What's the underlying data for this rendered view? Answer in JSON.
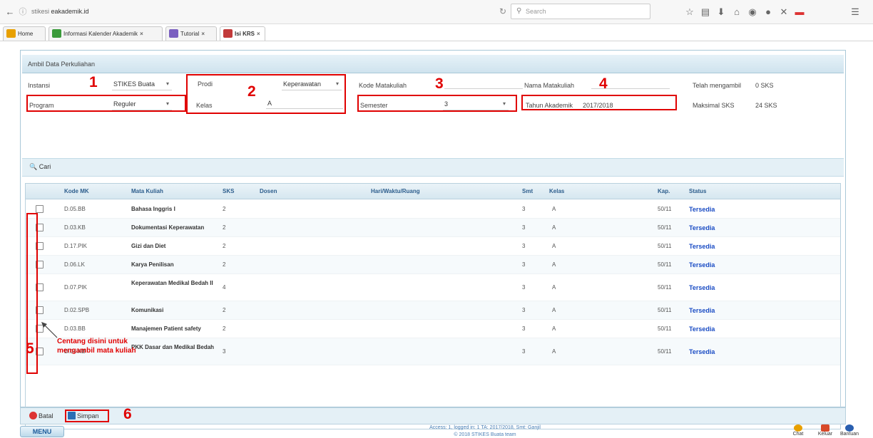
{
  "browser": {
    "url_prefix": "stikesi",
    "url_domain": "eakademik.id",
    "search_placeholder": "Search",
    "nav_back": "←",
    "nav_info": "ⓘ",
    "reload": "↻"
  },
  "tabs": [
    {
      "label": "Home",
      "color": "#e8a000"
    },
    {
      "label": "Informasi Kalender Akademik",
      "color": "#3a9a3a"
    },
    {
      "label": "Tutorial",
      "color": "#7a5fc0"
    },
    {
      "label": "Isi KRS",
      "color": "#c23a3a"
    }
  ],
  "panel": {
    "title": "Ambil Data Perkuliahan"
  },
  "form": {
    "instansi_label": "Instansi",
    "instansi_value": "STIKES Buata",
    "program_label": "Program",
    "program_value": "Reguler",
    "prodi_label": "Prodi",
    "prodi_value": "Keperawatan",
    "kelas_label": "Kelas",
    "kelas_value": "A",
    "kode_label": "Kode Matakuliah",
    "semester_label": "Semester",
    "semester_value": "3",
    "nama_label": "Nama Matakuliah",
    "tahun_label": "Tahun Akademik",
    "tahun_value": "2017/2018",
    "telah_label": "Telah mengambil",
    "telah_value": "0 SKS",
    "maks_label": "Maksimal SKS",
    "maks_value": "24 SKS"
  },
  "annotations": {
    "n1": "1",
    "n2": "2",
    "n3": "3",
    "n4": "4",
    "n5": "5",
    "n6": "6",
    "hint_line1": "Centang disini untuk",
    "hint_line2": "mengambil mata kuliah"
  },
  "cari_label": "Cari",
  "table": {
    "headers": [
      "Kode MK",
      "Mata Kuliah",
      "SKS",
      "Dosen",
      "Hari/Waktu/Ruang",
      "Smt",
      "Kelas",
      "Kap.",
      "Status"
    ],
    "rows": [
      {
        "kode": "D.05.BB",
        "mk": "Bahasa Inggris I",
        "sks": "2",
        "smt": "3",
        "kelas": "A",
        "kap": "50/11",
        "status": "Tersedia"
      },
      {
        "kode": "D.03.KB",
        "mk": "Dokumentasi Keperawatan",
        "sks": "2",
        "smt": "3",
        "kelas": "A",
        "kap": "50/11",
        "status": "Tersedia"
      },
      {
        "kode": "D.17.PIK",
        "mk": "Gizi dan Diet",
        "sks": "2",
        "smt": "3",
        "kelas": "A",
        "kap": "50/11",
        "status": "Tersedia"
      },
      {
        "kode": "D.06.LK",
        "mk": "Karya Penilisan",
        "sks": "2",
        "smt": "3",
        "kelas": "A",
        "kap": "50/11",
        "status": "Tersedia"
      },
      {
        "kode": "D.07.PIK",
        "mk": "Keperawatan Medikal Bedah II",
        "sks": "4",
        "smt": "3",
        "kelas": "A",
        "kap": "50/11",
        "status": "Tersedia"
      },
      {
        "kode": "D.02.SPB",
        "mk": "Komunikasi",
        "sks": "2",
        "smt": "3",
        "kelas": "A",
        "kap": "50/11",
        "status": "Tersedia"
      },
      {
        "kode": "D.03.BB",
        "mk": "Manajemen Patient safety",
        "sks": "2",
        "smt": "3",
        "kelas": "A",
        "kap": "50/11",
        "status": "Tersedia"
      },
      {
        "kode": "D.04.KB",
        "mk": "PKK Dasar dan Medikal Bedah",
        "sks": "3",
        "smt": "3",
        "kelas": "A",
        "kap": "50/11",
        "status": "Tersedia"
      }
    ]
  },
  "bottom": {
    "batal": "Batal",
    "simpan": "Simpan"
  },
  "footer": {
    "menu": "MENU",
    "line1": "Access: 1, logged in: 1 TA: 2017/2018, Smt: Ganjil",
    "line2": "© 2018 STIKES Buata team",
    "chat": "Chat",
    "keluar": "Keluar",
    "bantuan": "Bantuan"
  }
}
